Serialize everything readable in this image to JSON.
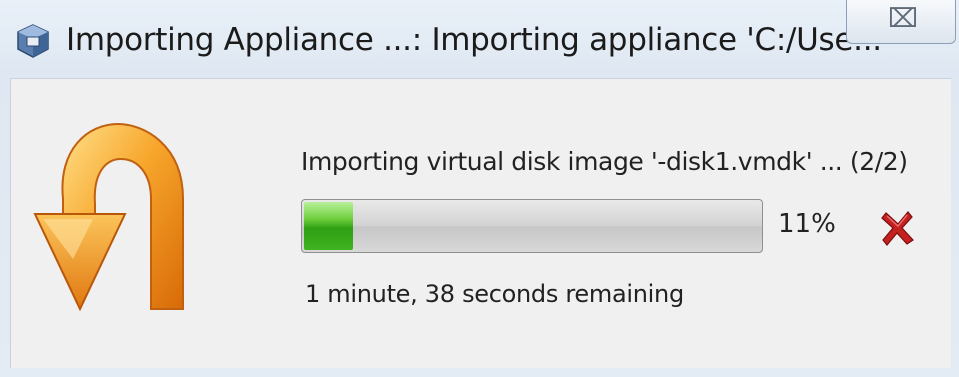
{
  "window": {
    "title": "Importing Appliance ...: Importing appliance 'C:/Use...",
    "close_symbol": "⌧",
    "icons": {
      "app": "virtualbox-cube-icon",
      "main": "import-arrow-icon",
      "cancel": "cancel-x-icon"
    }
  },
  "operation": {
    "description": "Importing virtual disk image '-disk1.vmdk' ... (2/2)",
    "progress_percent": 11,
    "progress_label": "11%",
    "time_remaining": "1 minute, 38 seconds remaining"
  },
  "colors": {
    "progress_green": "#3fb320",
    "arrow_orange": "#f0921e",
    "cancel_red": "#b01818"
  }
}
